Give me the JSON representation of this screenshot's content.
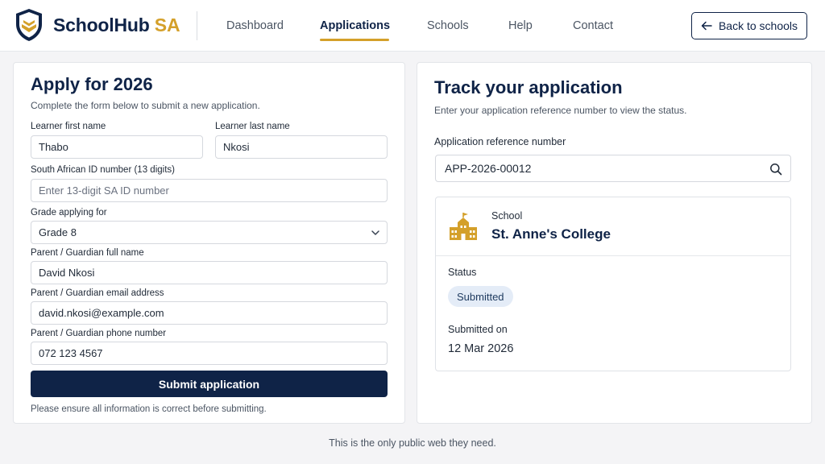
{
  "header": {
    "brand_main": "SchoolHub",
    "brand_accent": "SA",
    "nav": [
      "Dashboard",
      "Applications",
      "Schools",
      "Help",
      "Contact"
    ],
    "active_nav": "Applications",
    "back_label": "Back to schools"
  },
  "apply_form": {
    "title": "Apply for 2026",
    "subtitle": "Complete the form below to submit a new application.",
    "first_name_label": "Learner first name",
    "first_name_value": "Thabo",
    "last_name_label": "Learner last name",
    "last_name_value": "Nkosi",
    "id_label": "South African ID number (13 digits)",
    "id_placeholder": "Enter 13-digit SA ID number",
    "grade_label": "Grade applying for",
    "grade_value": "Grade 8",
    "guardian_name_label": "Parent / Guardian full name",
    "guardian_name_value": "David Nkosi",
    "guardian_email_label": "Parent / Guardian email address",
    "guardian_email_value": "david.nkosi@example.com",
    "guardian_phone_label": "Parent / Guardian phone number",
    "guardian_phone_value": "072 123 4567",
    "submit_label": "Submit application",
    "note": "Please ensure all information is correct before submitting."
  },
  "track": {
    "title": "Track your application",
    "subtitle": "Enter your application reference number to view the status.",
    "ref_label": "Application reference number",
    "ref_value": "APP-2026-00012",
    "school_label": "School",
    "school_name": "St. Anne's College",
    "status_label": "Status",
    "status_value": "Submitted",
    "submitted_on_label": "Submitted on",
    "submitted_on_value": "12 Mar 2026"
  },
  "footer": "This is the only public web they need.",
  "colors": {
    "navy": "#0f2347",
    "gold": "#d4a02a",
    "badge_bg": "#e4ecf7"
  },
  "icons": [
    "shield-logo-icon",
    "arrow-left-icon",
    "chevron-down-icon",
    "search-icon",
    "school-building-icon"
  ]
}
